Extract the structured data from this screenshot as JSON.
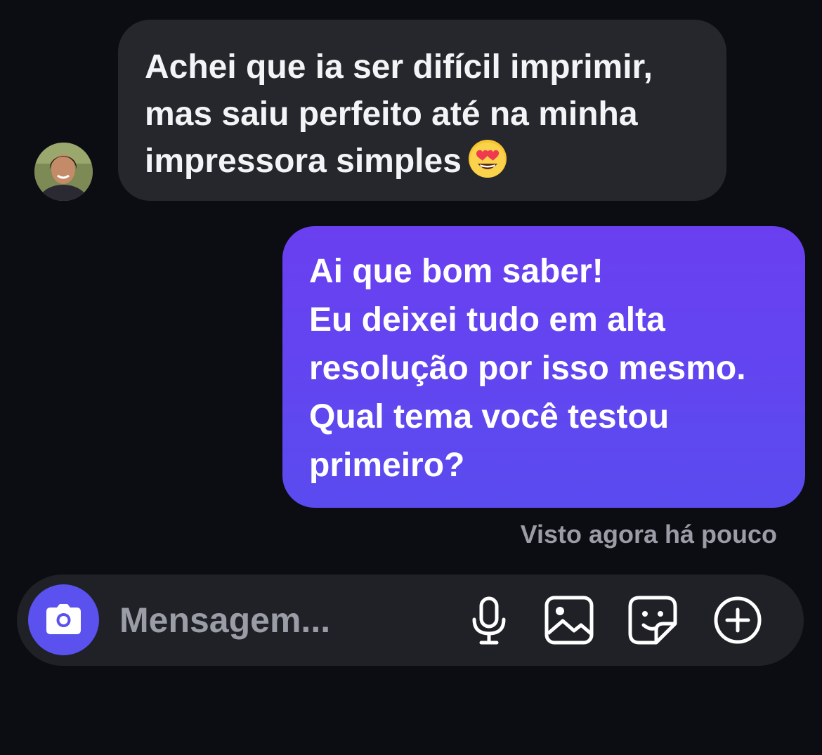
{
  "thread": {
    "incoming": {
      "lines": [
        "Achei que ia ser difícil imprimir,",
        "mas saiu perfeito até na minha",
        "impressora simples"
      ],
      "emoji": "smiling-face-heart-eyes"
    },
    "outgoing": {
      "lines": [
        "Ai que bom saber!",
        "Eu deixei tudo em alta",
        "resolução por isso mesmo.",
        "Qual tema você testou",
        "primeiro?"
      ]
    },
    "seen_status": "Visto agora há pouco"
  },
  "composer": {
    "placeholder": "Mensagem...",
    "icons": [
      "camera-icon",
      "microphone-icon",
      "gallery-icon",
      "sticker-icon",
      "plus-circle-icon"
    ]
  },
  "colors": {
    "background": "#0c0d12",
    "incoming_bubble": "#25272d",
    "outgoing_bubble_top": "#6a3ff0",
    "outgoing_bubble_bottom": "#5a4bef",
    "camera_button": "#5a51ee",
    "muted_text": "#9a9ca6"
  }
}
